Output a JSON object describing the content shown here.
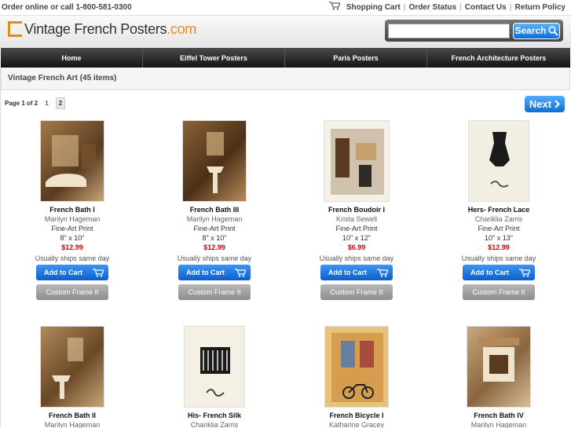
{
  "topbar": {
    "phone": "Order online or call 1-800-581-0300",
    "links": [
      "Shopping Cart",
      "Order Status",
      "Contact Us",
      "Return Policy"
    ]
  },
  "logo": {
    "text": "Vintage French Posters",
    "suffix": ".com"
  },
  "search": {
    "value": "",
    "placeholder": "",
    "button": "Search"
  },
  "nav": [
    "Home",
    "Eiffel Tower Posters",
    "Paris Posters",
    "French Architecture Posters"
  ],
  "category": {
    "title": "Vintage French Art (45 items)"
  },
  "pager": {
    "label": "Page 1 of 2",
    "pages": [
      "1",
      "2"
    ],
    "current": "2",
    "next": "Next"
  },
  "products": [
    {
      "title": "French Bath I",
      "artist": "Marilyn Hageman",
      "format": "Fine-Art Print",
      "size": "8\" x 10\"",
      "price": "$12.99",
      "ships": "Usually ships same day",
      "cart": "Add to Cart",
      "frame": "Custom Frame It"
    },
    {
      "title": "French Bath III",
      "artist": "Marilyn Hageman",
      "format": "Fine-Art Print",
      "size": "8\" x 10\"",
      "price": "$12.99",
      "ships": "Usually ships same day",
      "cart": "Add to Cart",
      "frame": "Custom Frame It"
    },
    {
      "title": "French Boudoir I",
      "artist": "Krista Sewell",
      "format": "Fine-Art Print",
      "size": "10\" x 12\"",
      "price": "$6.99",
      "ships": "Usually ships same day",
      "cart": "Add to Cart",
      "frame": "Custom Frame It"
    },
    {
      "title": "Hers- French Lace",
      "artist": "Chariklia Zarris",
      "format": "Fine-Art Print",
      "size": "10\" x 13\"",
      "price": "$12.99",
      "ships": "Usually ships same day",
      "cart": "Add to Cart",
      "frame": "Custom Frame It"
    },
    {
      "title": "French Bath II",
      "artist": "Marilyn Hageman"
    },
    {
      "title": "His- French Silk",
      "artist": "Chariklia Zarris"
    },
    {
      "title": "French Bicycle I",
      "artist": "Katharine Gracey"
    },
    {
      "title": "French Bath IV",
      "artist": "Marilyn Hageman"
    }
  ],
  "colors": {
    "accent": "#e58a1f",
    "button_blue": "#0a6fd3",
    "price_red": "#d40000"
  }
}
